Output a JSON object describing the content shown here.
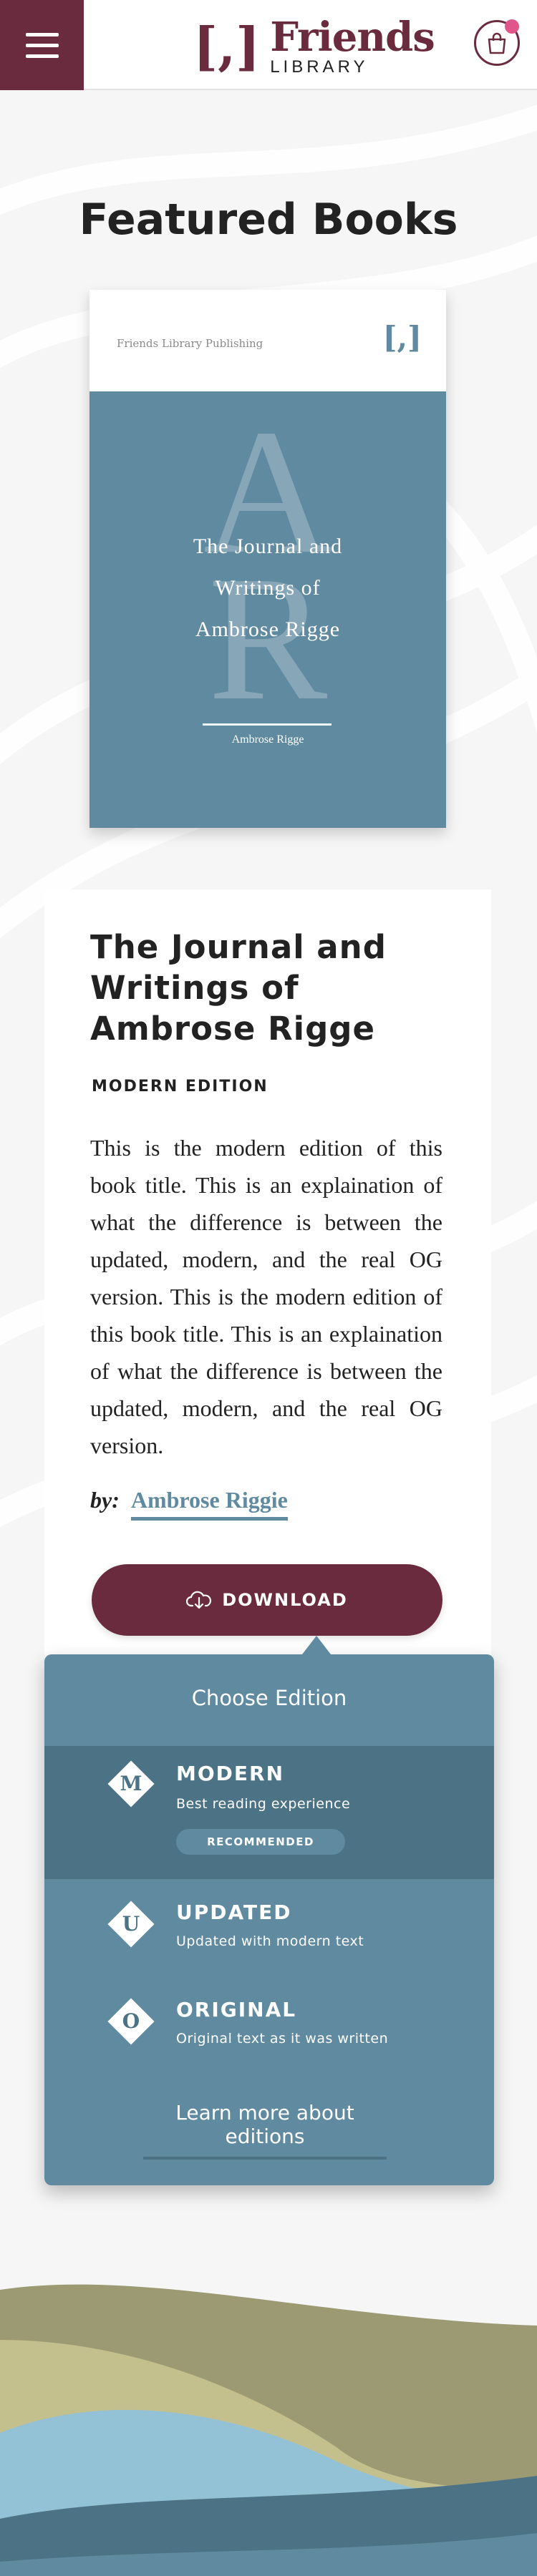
{
  "colors": {
    "brand": "#6b2b3f",
    "accent": "#5f8aa0",
    "accent_dark": "#4b7385",
    "notification": "#e0558a",
    "footer_olive": "#9b9a72",
    "footer_khaki": "#c3c08e",
    "footer_sky": "#93c1d6",
    "footer_blue": "#4b7385"
  },
  "header": {
    "menu_icon": "hamburger-icon",
    "logo_bracket": "[,]",
    "logo_name": "Friends",
    "logo_sub": "LIBRARY",
    "cart_icon": "shopping-bag-icon"
  },
  "main": {
    "heading": "Featured Books"
  },
  "book": {
    "publisher": "Friends Library Publishing",
    "cover_logo": "[,]",
    "initial_1": "A",
    "initial_2": "R",
    "cover_title": "The Journal and Writings of Ambrose Rigge",
    "cover_author": "Ambrose Rigge",
    "title": "The Journal and Writings of Ambrose Rigge",
    "edition": "MODERN EDITION",
    "description": "This is the modern edition of this book title. This is an explaination of what the difference is between the updated, modern, and the real OG version. This is the modern edition of this book title. This is an explaination of what the difference is between the updated, modern, and the real OG version.",
    "by_label": "by:",
    "author_link": "Ambrose Riggie"
  },
  "download": {
    "label": "DOWNLOAD",
    "icon": "cloud-download-icon"
  },
  "editions_popover": {
    "title": "Choose Edition",
    "options": [
      {
        "letter": "M",
        "name": "MODERN",
        "description": "Best reading experience",
        "badge": "RECOMMENDED",
        "selected": true
      },
      {
        "letter": "U",
        "name": "UPDATED",
        "description": "Updated with modern text",
        "selected": false
      },
      {
        "letter": "O",
        "name": "ORIGINAL",
        "description": "Original text as it was written",
        "selected": false
      }
    ],
    "learn_more": "Learn more about editions"
  }
}
